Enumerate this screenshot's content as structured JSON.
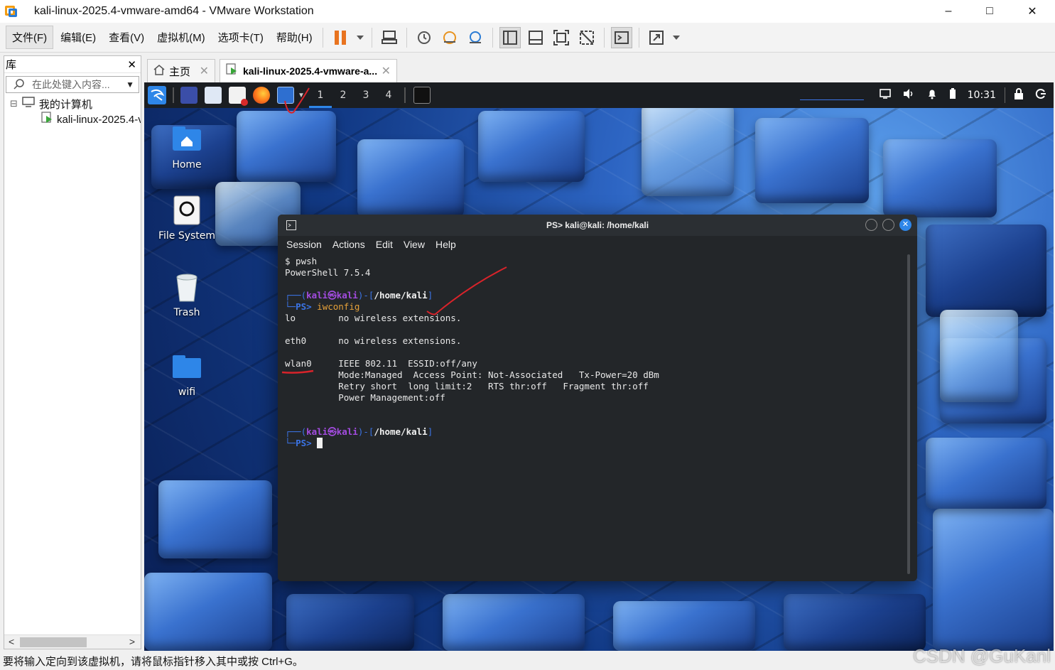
{
  "window": {
    "title": "kali-linux-2025.4-vmware-amd64 - VMware Workstation",
    "minimize": "–",
    "maximize": "□",
    "close": "✕"
  },
  "menu": {
    "items": [
      "文件(F)",
      "编辑(E)",
      "查看(V)",
      "虚拟机(M)",
      "选项卡(T)",
      "帮助(H)"
    ]
  },
  "library": {
    "title": "库",
    "close": "✕",
    "search_placeholder": "在此处键入内容...",
    "tree": [
      {
        "label": "我的计算机",
        "expander": "⊟"
      },
      {
        "label": "kali-linux-2025.4-vmware-amd64"
      }
    ],
    "scroll_left": "<",
    "scroll_right": ">"
  },
  "tabs": [
    {
      "label": "主页",
      "close": "✕"
    },
    {
      "label": "kali-linux-2025.4-vmware-a...",
      "close": "✕"
    }
  ],
  "kali_panel": {
    "workspaces": [
      "1",
      "2",
      "3",
      "4"
    ],
    "clock": "10:31"
  },
  "desktop_icons": [
    {
      "label": "Home",
      "icon": "home-folder-icon"
    },
    {
      "label": "File System",
      "icon": "drive-icon"
    },
    {
      "label": "Trash",
      "icon": "trash-icon"
    },
    {
      "label": "wifi",
      "icon": "folder-icon"
    }
  ],
  "terminal": {
    "title": "PS> kali@kali: /home/kali",
    "menu": [
      "Session",
      "Actions",
      "Edit",
      "View",
      "Help"
    ],
    "lines": {
      "l1": "$ pwsh",
      "l2": "PowerShell 7.5.4",
      "prompt_user": "kali",
      "prompt_at": "㉿",
      "prompt_host": "kali",
      "prompt_path": "/home/kali",
      "ps": "PS>",
      "cmd": "iwconfig",
      "lo": "lo        no wireless extensions.",
      "eth0": "eth0      no wireless extensions.",
      "wlan0_name": "wlan0",
      "wlan0_1": "     IEEE 802.11  ESSID:off/any",
      "wlan0_2": "          Mode:Managed  Access Point: Not-Associated   Tx-Power=20 dBm",
      "wlan0_3": "          Retry short  long limit:2   RTS thr:off   Fragment thr:off",
      "wlan0_4": "          Power Management:off"
    }
  },
  "status": {
    "text": "要将输入定向到该虚拟机，请将鼠标指针移入其中或按 Ctrl+G。"
  },
  "watermark": "CSDN @GuKanl",
  "colors": {
    "accent_orange": "#e8731f",
    "kali_purple": "#a34ce0",
    "kali_blue": "#3b74e6",
    "annotation_red": "#d9232a"
  }
}
